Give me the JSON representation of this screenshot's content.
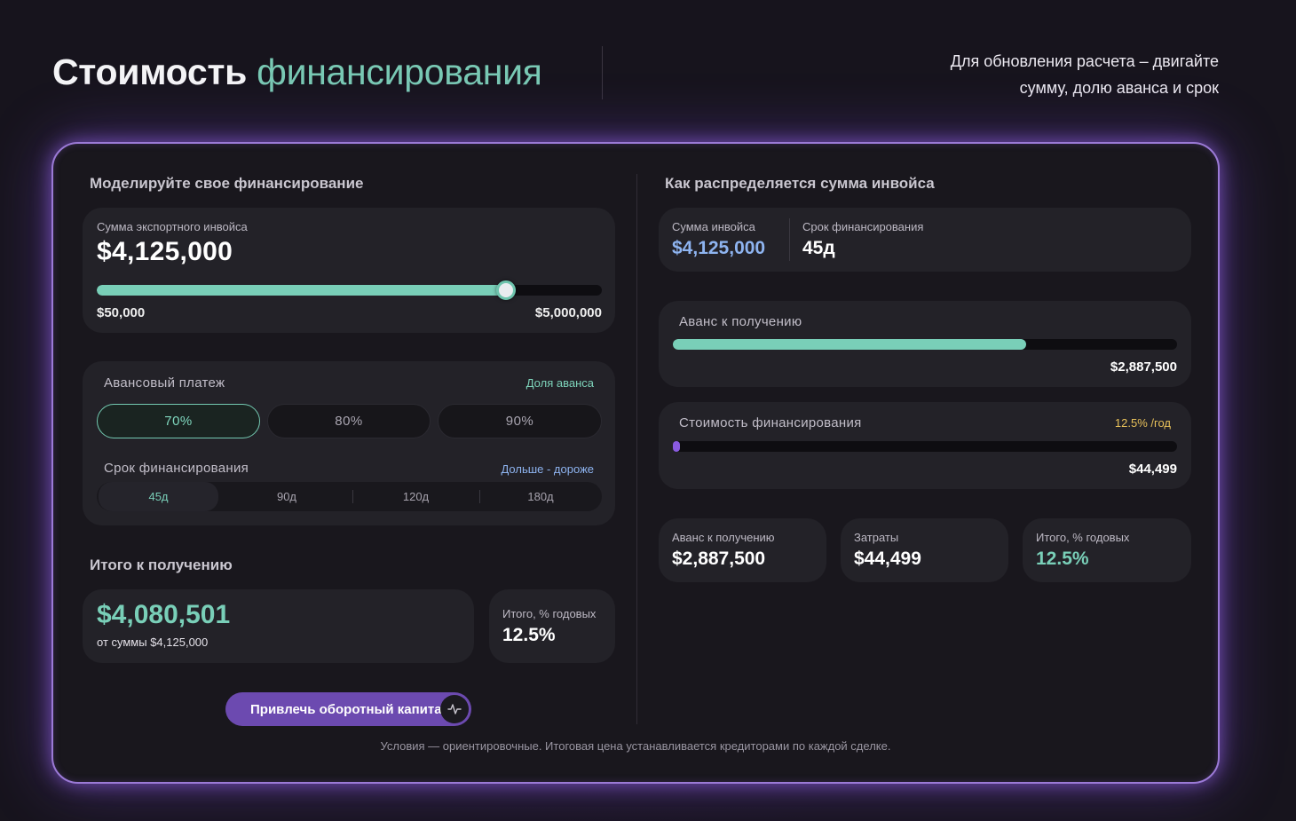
{
  "header": {
    "title_main": "Стоимость",
    "title_accent": "финансирования",
    "hint_line1": "Для обновления расчета – двигайте",
    "hint_line2": "сумму, долю аванса и срок"
  },
  "left": {
    "section_title": "Моделируйте свое финансирование",
    "invoice": {
      "label": "Сумма экспортного инвойса",
      "value": "$4,125,000",
      "slider_level": 0.81,
      "min_label": "$50,000",
      "max_label": "$5,000,000"
    },
    "advance": {
      "label": "Авансовый платеж",
      "link": "Доля аванса",
      "options": [
        "70%",
        "80%",
        "90%"
      ],
      "selected": "70%"
    },
    "term": {
      "label": "Срок финансирования",
      "link": "Дольше - дороже",
      "options": [
        "45д",
        "90д",
        "120д",
        "180д"
      ],
      "selected": "45д"
    },
    "total": {
      "title": "Итого к получению",
      "value": "$4,080,501",
      "sub": "от суммы $4,125,000",
      "rate_label": "Итого, % годовых",
      "rate_value": "12.5%"
    },
    "cta_label": "Привлечь оборотный капитал",
    "cta_icon": "activity-pulse-icon"
  },
  "right": {
    "section_title": "Как распределяется сумма инвойса",
    "summary": {
      "invoice_label": "Сумма инвойса",
      "invoice_value": "$4,125,000",
      "term_label": "Срок финансирования",
      "term_value": "45д"
    },
    "advance_bar": {
      "label": "Аванс к получению",
      "value": "$2,887,500",
      "fraction": 0.7
    },
    "cost_bar": {
      "label": "Стоимость финансирования",
      "rate": "12.5% /год",
      "value": "$44,499",
      "fraction": 0.011
    },
    "stats": [
      {
        "label": "Аванс к получению",
        "value": "$2,887,500"
      },
      {
        "label": "Затраты",
        "value": "$44,499"
      },
      {
        "label": "Итого, % годовых",
        "value": "12.5%"
      }
    ]
  },
  "footnote": "Условия — ориентировочные. Итоговая цена устанавливается кредиторами по каждой сделке.",
  "colors": {
    "accent_green": "#79cfb8",
    "accent_purple": "#6c4ab0",
    "accent_blue": "#8eb4f0",
    "accent_yellow": "#e8c15a"
  }
}
